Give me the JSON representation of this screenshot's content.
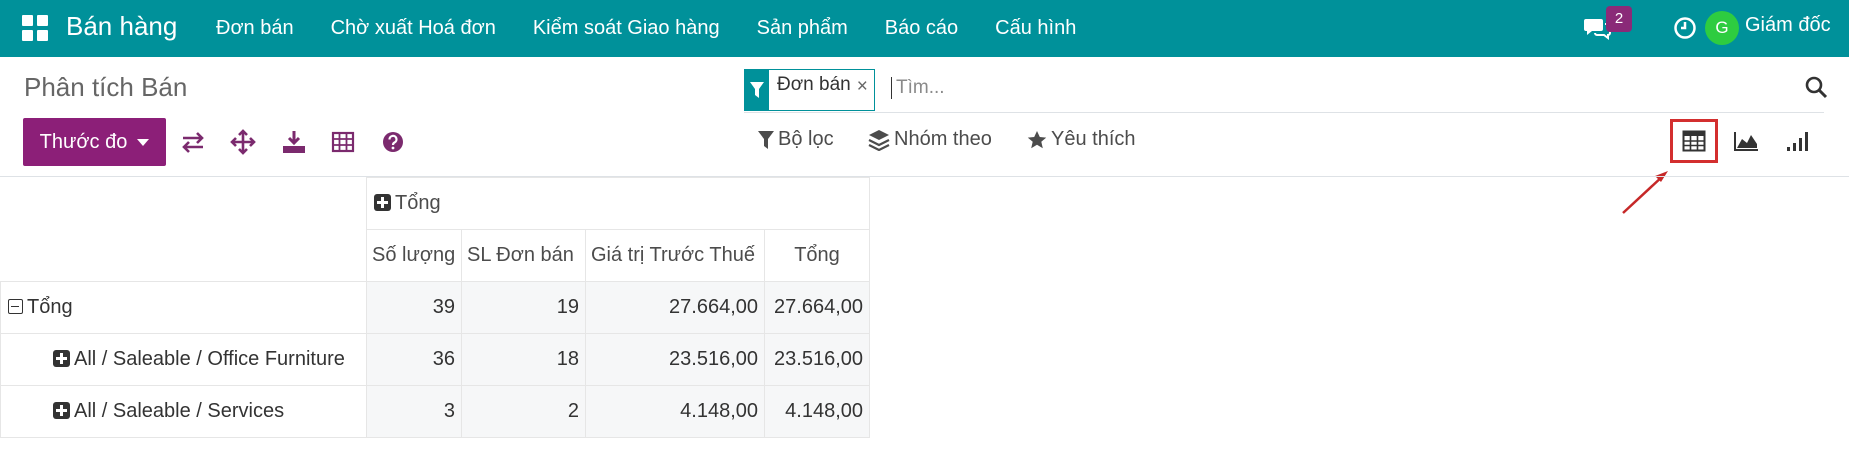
{
  "navbar": {
    "app_name": "Bán hàng",
    "menu": [
      "Đơn bán",
      "Chờ xuất Hoá đơn",
      "Kiểm soát Giao hàng",
      "Sản phẩm",
      "Báo cáo",
      "Cấu hình"
    ],
    "messages_count": "2",
    "user_initial": "G",
    "user_name": "Giám đốc",
    "bg_color": "#00919a"
  },
  "control_panel": {
    "title": "Phân tích Bán",
    "search": {
      "facet_label": "Đơn bán",
      "placeholder": "Tìm..."
    },
    "measures_button": "Thước đo",
    "toolbar_icons": [
      "flip-axis-icon",
      "expand-all-icon",
      "download-icon",
      "table-icon",
      "help-icon"
    ],
    "filters": {
      "filter_label": "Bộ lọc",
      "group_label": "Nhóm theo",
      "favorite_label": "Yêu thích"
    },
    "views": [
      "pivot-view-icon",
      "graph-view-icon",
      "bar-view-icon"
    ],
    "active_view": "pivot"
  },
  "pivot": {
    "col_group_header": "Tổng",
    "measures": [
      "Số lượng",
      "SL Đơn bán",
      "Giá trị Trước Thuế",
      "Tổng"
    ],
    "rows": [
      {
        "label": "Tổng",
        "values": [
          "39",
          "19",
          "27.664,00",
          "27.664,00"
        ]
      },
      {
        "label": "All / Saleable / Office Furniture",
        "values": [
          "36",
          "18",
          "23.516,00",
          "23.516,00"
        ]
      },
      {
        "label": "All / Saleable / Services",
        "values": [
          "3",
          "2",
          "4.148,00",
          "4.148,00"
        ]
      }
    ]
  },
  "colors": {
    "primary": "#8c1f78",
    "highlight": "#d32f2f"
  }
}
